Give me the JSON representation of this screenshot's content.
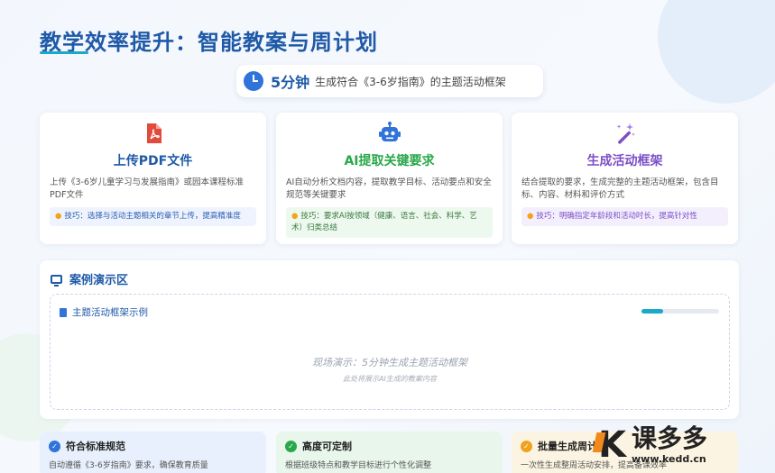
{
  "header": {
    "title": "教学效率提升：智能教案与周计划"
  },
  "highlight": {
    "time": "5分钟",
    "text": "生成符合《3-6岁指南》的主题活动框架",
    "icon": "clock-icon"
  },
  "steps": [
    {
      "icon": "pdf-icon",
      "title": "上传PDF文件",
      "color": "#1f5aa8",
      "desc": "上传《3-6岁儿童学习与发展指南》或园本课程标准PDF文件",
      "tip": "技巧：选择与活动主题相关的章节上传，提高精准度"
    },
    {
      "icon": "robot-icon",
      "title": "AI提取关键要求",
      "color": "#29a84a",
      "desc": "AI自动分析文档内容，提取教学目标、活动要点和安全规范等关键要求",
      "tip": "技巧：要求AI按领域（健康、语言、社会、科学、艺术）归类总结"
    },
    {
      "icon": "magic-wand-icon",
      "title": "生成活动框架",
      "color": "#7b4fc6",
      "desc": "结合提取的要求，生成完整的主题活动框架，包含目标、内容、材料和评价方式",
      "tip": "技巧：明确指定年龄段和活动时长，提高针对性"
    }
  ],
  "demo": {
    "title": "案例演示区",
    "sub_title": "主题活动框架示例",
    "progress": 0.28,
    "main_text": "现场演示：5分钟生成主题活动框架",
    "sub_text": "此处将展示AI生成的教案内容"
  },
  "features": [
    {
      "title": "符合标准规范",
      "desc": "自动遵循《3-6岁指南》要求，确保教育质量"
    },
    {
      "title": "高度可定制",
      "desc": "根据班级特点和教学目标进行个性化调整"
    },
    {
      "title": "批量生成周计划",
      "desc": "一次性生成整周活动安排，提高备课效率"
    }
  ],
  "watermark": {
    "name": "课多多",
    "url": "www.kedd.cn"
  },
  "colors": {
    "primary": "#1f5aa8",
    "accent": "#1aa9c9",
    "green": "#29a84a",
    "purple": "#7b4fc6",
    "orange": "#f0a11d"
  }
}
